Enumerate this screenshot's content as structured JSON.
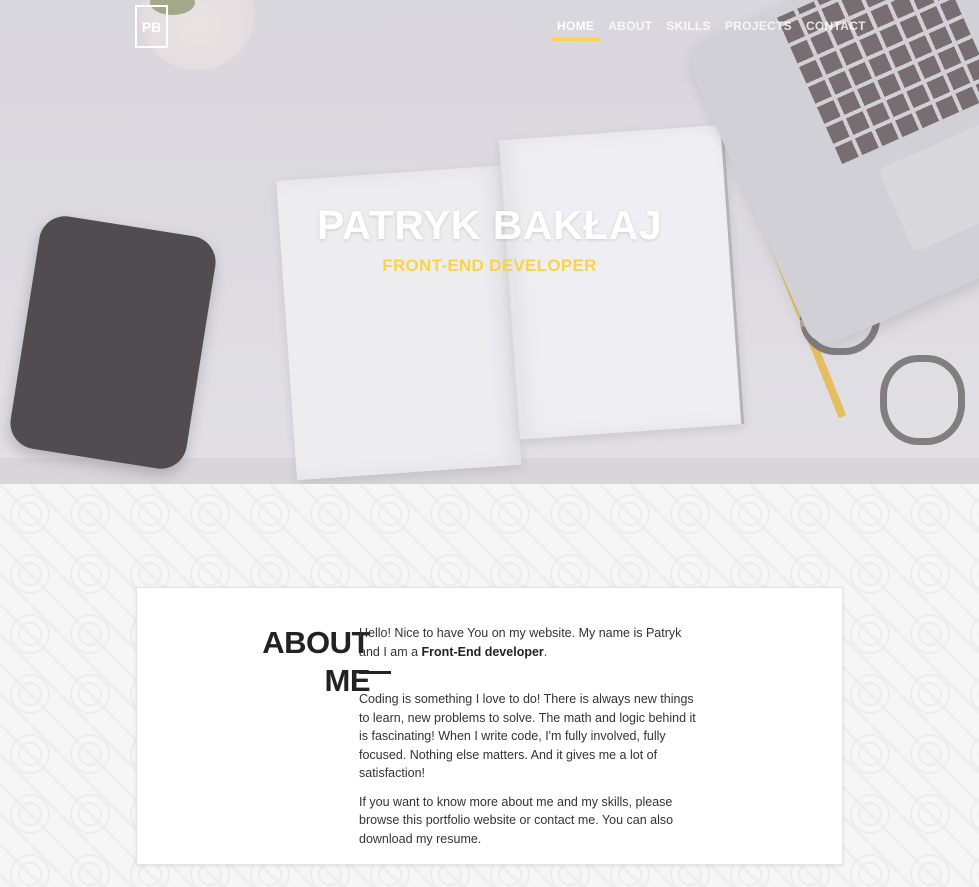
{
  "logo": {
    "text": "PB"
  },
  "nav": {
    "items": [
      {
        "label": "HOME",
        "active": true
      },
      {
        "label": "ABOUT",
        "active": false
      },
      {
        "label": "SKILLS",
        "active": false
      },
      {
        "label": "PROJECTS",
        "active": false
      },
      {
        "label": "CONTACT",
        "active": false
      }
    ]
  },
  "hero": {
    "title": "PATRYK BAKŁAJ",
    "subtitle": "FRONT-END DEVELOPER"
  },
  "about": {
    "heading_line1": "ABOUT",
    "heading_line2": "ME",
    "intro_before": "Hello! Nice to have You on my website. My name is Patryk and I am a ",
    "intro_strong": "Front-End developer",
    "intro_after": ".",
    "paragraph2": "Coding is something I love to do! There is always new things to learn, new problems to solve. The math and logic behind it is fascinating! When I write code, I'm fully involved, fully focused. Nothing else matters. And it gives me a lot of satisfaction!",
    "paragraph3": "If you want to know more about me and my skills, please browse this portfolio website or contact me. You can also download my resume."
  },
  "colors": {
    "accent": "#ffd54f",
    "subtitle": "#f7d44a",
    "heading": "#222222"
  }
}
